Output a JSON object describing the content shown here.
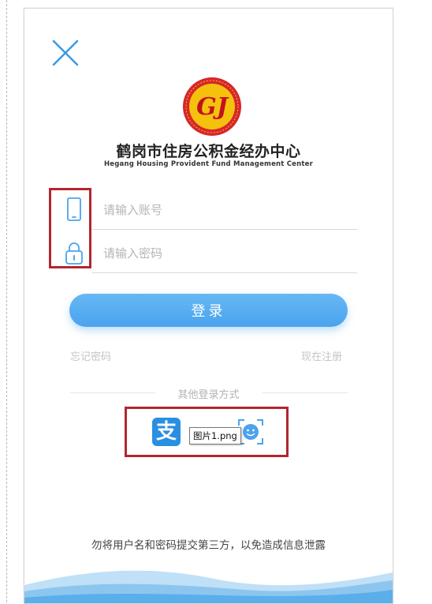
{
  "header": {
    "close_icon": "close-icon"
  },
  "organization": {
    "logo_text": "GJ",
    "name_cn": "鹤岗市住房公积金经办中心",
    "name_en": "Hegang Housing Provident Fund Management Center"
  },
  "form": {
    "account_placeholder": "请输入账号",
    "account_icon": "phone-icon",
    "password_placeholder": "请输入密码",
    "password_icon": "lock-icon",
    "login_label": "登录",
    "forgot_label": "忘记密码",
    "register_label": "现在注册"
  },
  "other_login": {
    "label": "其他登录方式",
    "alipay_icon_text": "支",
    "tooltip": "图片1.png"
  },
  "footer": {
    "disclaimer": "勿将用户名和密码提交第三方，以免造成信息泄露"
  },
  "colors": {
    "primary": "#4aa3ee",
    "highlight": "#b3262e",
    "logo_red": "#d7262d",
    "logo_yellow": "#f4c20d"
  }
}
